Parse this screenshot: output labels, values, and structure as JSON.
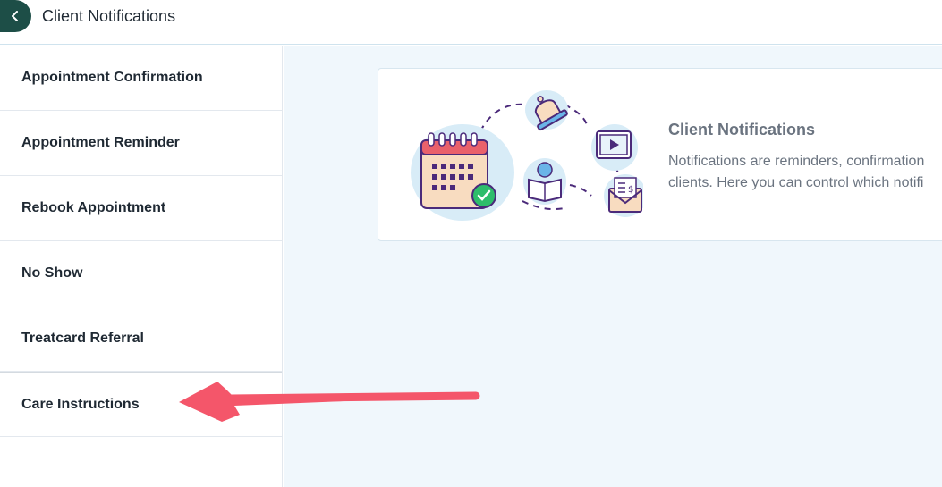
{
  "header": {
    "title": "Client Notifications"
  },
  "sidebar": {
    "items": [
      {
        "label": "Appointment Confirmation"
      },
      {
        "label": "Appointment Reminder"
      },
      {
        "label": "Rebook Appointment"
      },
      {
        "label": "No Show"
      },
      {
        "label": "Treatcard Referral"
      },
      {
        "label": "Care Instructions"
      }
    ]
  },
  "info_card": {
    "title": "Client Notifications",
    "description_line1": "Notifications are reminders, confirmation",
    "description_line2": "clients. Here you can control which notifi"
  },
  "icons": [
    "chevron-left-icon",
    "calendar-icon",
    "check-icon",
    "bell-icon",
    "video-icon",
    "book-icon",
    "envelope-icon"
  ],
  "colors": {
    "back_button": "#1d4e47",
    "main_background": "#f0f7fc",
    "annotation_arrow": "#f4566a"
  }
}
